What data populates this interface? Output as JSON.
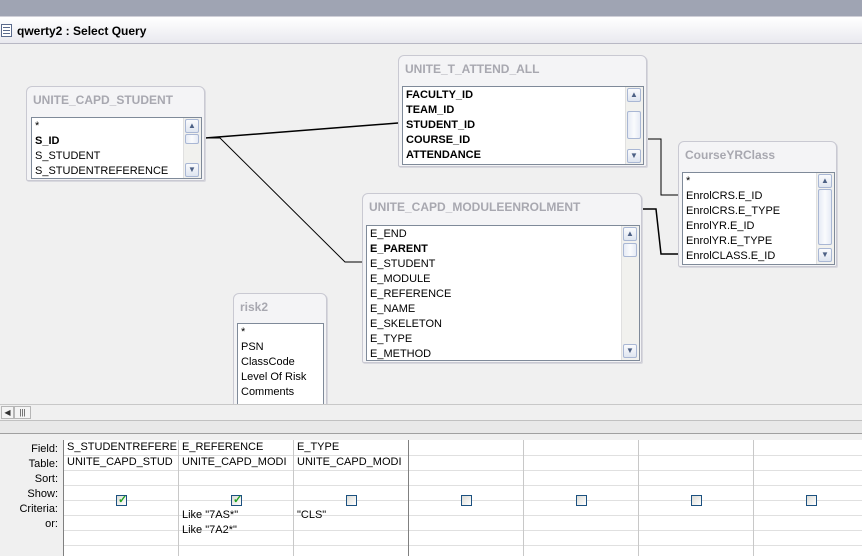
{
  "window": {
    "title": "qwerty2 : Select Query"
  },
  "tables": {
    "student": {
      "name": "UNITE_CAPD_STUDENT",
      "fields": [
        "*",
        "S_ID",
        "S_STUDENT",
        "S_STUDENTREFERENCE"
      ]
    },
    "attend": {
      "name": "UNITE_T_ATTEND_ALL",
      "fields": [
        "FACULTY_ID",
        "TEAM_ID",
        "STUDENT_ID",
        "COURSE_ID",
        "ATTENDANCE"
      ]
    },
    "course": {
      "name": "CourseYRClass",
      "fields": [
        "*",
        "EnrolCRS.E_ID",
        "EnrolCRS.E_TYPE",
        "EnrolYR.E_ID",
        "EnrolYR.E_TYPE",
        "EnrolCLASS.E_ID"
      ]
    },
    "module": {
      "name": "UNITE_CAPD_MODULEENROLMENT",
      "fields": [
        "E_END",
        "E_PARENT",
        "E_STUDENT",
        "E_MODULE",
        "E_REFERENCE",
        "E_NAME",
        "E_SKELETON",
        "E_TYPE",
        "E_METHOD"
      ]
    },
    "risk": {
      "name": "risk2",
      "fields": [
        "*",
        "PSN",
        "ClassCode",
        "Level Of Risk",
        "Comments"
      ]
    }
  },
  "grid": {
    "labels": {
      "field": "Field:",
      "table": "Table:",
      "sort": "Sort:",
      "show": "Show:",
      "criteria": "Criteria:",
      "or": "or:"
    },
    "columns": [
      {
        "field": "S_STUDENTREFERE",
        "table": "UNITE_CAPD_STUD",
        "sort": "",
        "show": true,
        "criteria": "",
        "or": ""
      },
      {
        "field": "E_REFERENCE",
        "table": "UNITE_CAPD_MODI",
        "sort": "",
        "show": true,
        "criteria": "Like \"7AS*\"",
        "or": "Like \"7A2*\""
      },
      {
        "field": "E_TYPE",
        "table": "UNITE_CAPD_MODI",
        "sort": "",
        "show": false,
        "criteria": "\"CLS\"",
        "or": ""
      },
      {
        "field": "",
        "table": "",
        "sort": "",
        "show": false,
        "criteria": "",
        "or": ""
      },
      {
        "field": "",
        "table": "",
        "sort": "",
        "show": false,
        "criteria": "",
        "or": ""
      },
      {
        "field": "",
        "table": "",
        "sort": "",
        "show": false,
        "criteria": "",
        "or": ""
      },
      {
        "field": "",
        "table": "",
        "sort": "",
        "show": false,
        "criteria": "",
        "or": ""
      }
    ]
  },
  "icons": {
    "window": "query-window-icon",
    "scroll_up": "scroll-up-icon",
    "scroll_down": "scroll-down-icon",
    "scroll_left": "scroll-left-icon"
  },
  "colors": {
    "checkmark": "#21a121",
    "table_title": "#a8a8b0",
    "top_bar": "#9fa4b3"
  }
}
